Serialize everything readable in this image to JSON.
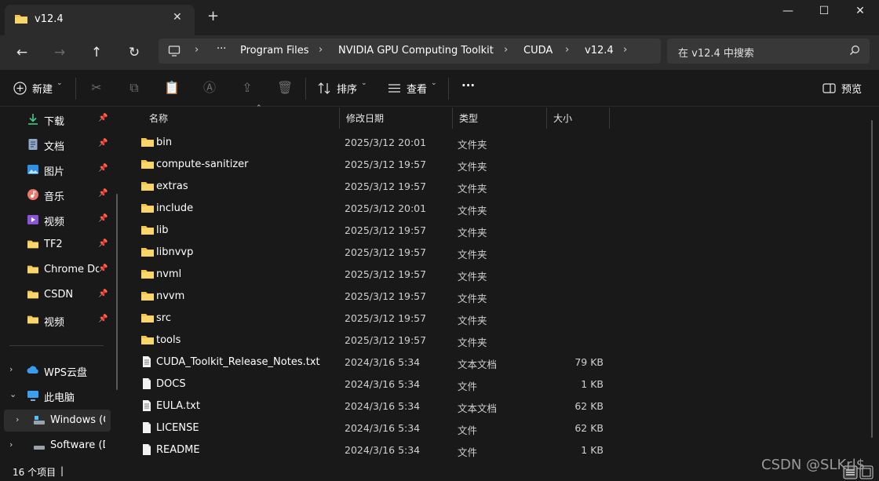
{
  "window": {
    "tab_title": "v12.4",
    "new_tab": "+",
    "close_tab": "✕",
    "minimize": "—",
    "maximize": "☐",
    "close": "✕"
  },
  "nav": {
    "back": "←",
    "forward": "→",
    "up": "↑",
    "refresh": "↻"
  },
  "address": {
    "more": "···",
    "crumbs": [
      "Program Files",
      "NVIDIA GPU Computing Toolkit",
      "CUDA",
      "v12.4"
    ]
  },
  "search": {
    "placeholder": "在 v12.4 中搜索"
  },
  "toolbar": {
    "new_label": "新建",
    "sort_label": "排序",
    "view_label": "查看",
    "more": "···",
    "preview_label": "预览"
  },
  "sidebar": {
    "quick": [
      {
        "label": "下载",
        "icon": "download-icon"
      },
      {
        "label": "文档",
        "icon": "document-icon"
      },
      {
        "label": "图片",
        "icon": "picture-icon"
      },
      {
        "label": "音乐",
        "icon": "music-icon"
      },
      {
        "label": "视频",
        "icon": "video-icon"
      },
      {
        "label": "TF2",
        "icon": "folder-icon"
      },
      {
        "label": "Chrome Dow",
        "icon": "folder-icon"
      },
      {
        "label": "CSDN",
        "icon": "folder-icon"
      },
      {
        "label": "视频",
        "icon": "folder-icon"
      }
    ],
    "tree": [
      {
        "label": "WPS云盘",
        "icon": "cloud-icon",
        "expander": "›"
      },
      {
        "label": "此电脑",
        "icon": "computer-icon",
        "expander": "⌄"
      },
      {
        "label": "Windows (C:)",
        "icon": "drive-icon",
        "expander": "›"
      },
      {
        "label": "Software (D:)",
        "icon": "drive-icon",
        "expander": "›"
      }
    ]
  },
  "columns": {
    "name": "名称",
    "date": "修改日期",
    "type": "类型",
    "size": "大小"
  },
  "files": [
    {
      "name": "bin",
      "date": "2025/3/12 20:01",
      "type": "文件夹",
      "size": "",
      "kind": "folder"
    },
    {
      "name": "compute-sanitizer",
      "date": "2025/3/12 19:57",
      "type": "文件夹",
      "size": "",
      "kind": "folder"
    },
    {
      "name": "extras",
      "date": "2025/3/12 19:57",
      "type": "文件夹",
      "size": "",
      "kind": "folder"
    },
    {
      "name": "include",
      "date": "2025/3/12 20:01",
      "type": "文件夹",
      "size": "",
      "kind": "folder"
    },
    {
      "name": "lib",
      "date": "2025/3/12 19:57",
      "type": "文件夹",
      "size": "",
      "kind": "folder"
    },
    {
      "name": "libnvvp",
      "date": "2025/3/12 19:57",
      "type": "文件夹",
      "size": "",
      "kind": "folder"
    },
    {
      "name": "nvml",
      "date": "2025/3/12 19:57",
      "type": "文件夹",
      "size": "",
      "kind": "folder"
    },
    {
      "name": "nvvm",
      "date": "2025/3/12 19:57",
      "type": "文件夹",
      "size": "",
      "kind": "folder"
    },
    {
      "name": "src",
      "date": "2025/3/12 19:57",
      "type": "文件夹",
      "size": "",
      "kind": "folder"
    },
    {
      "name": "tools",
      "date": "2025/3/12 19:57",
      "type": "文件夹",
      "size": "",
      "kind": "folder"
    },
    {
      "name": "CUDA_Toolkit_Release_Notes.txt",
      "date": "2024/3/16 5:34",
      "type": "文本文档",
      "size": "79 KB",
      "kind": "text"
    },
    {
      "name": "DOCS",
      "date": "2024/3/16 5:34",
      "type": "文件",
      "size": "1 KB",
      "kind": "file"
    },
    {
      "name": "EULA.txt",
      "date": "2024/3/16 5:34",
      "type": "文本文档",
      "size": "62 KB",
      "kind": "text"
    },
    {
      "name": "LICENSE",
      "date": "2024/3/16 5:34",
      "type": "文件",
      "size": "62 KB",
      "kind": "file"
    },
    {
      "name": "README",
      "date": "2024/3/16 5:34",
      "type": "文件",
      "size": "1 KB",
      "kind": "file"
    }
  ],
  "status": {
    "count": "16 个项目",
    "divider": "|"
  },
  "watermark": "CSDN @SLKrl$",
  "colors": {
    "folder": "#f4c44f",
    "background": "#191919",
    "accent": "#4cc2ff"
  }
}
